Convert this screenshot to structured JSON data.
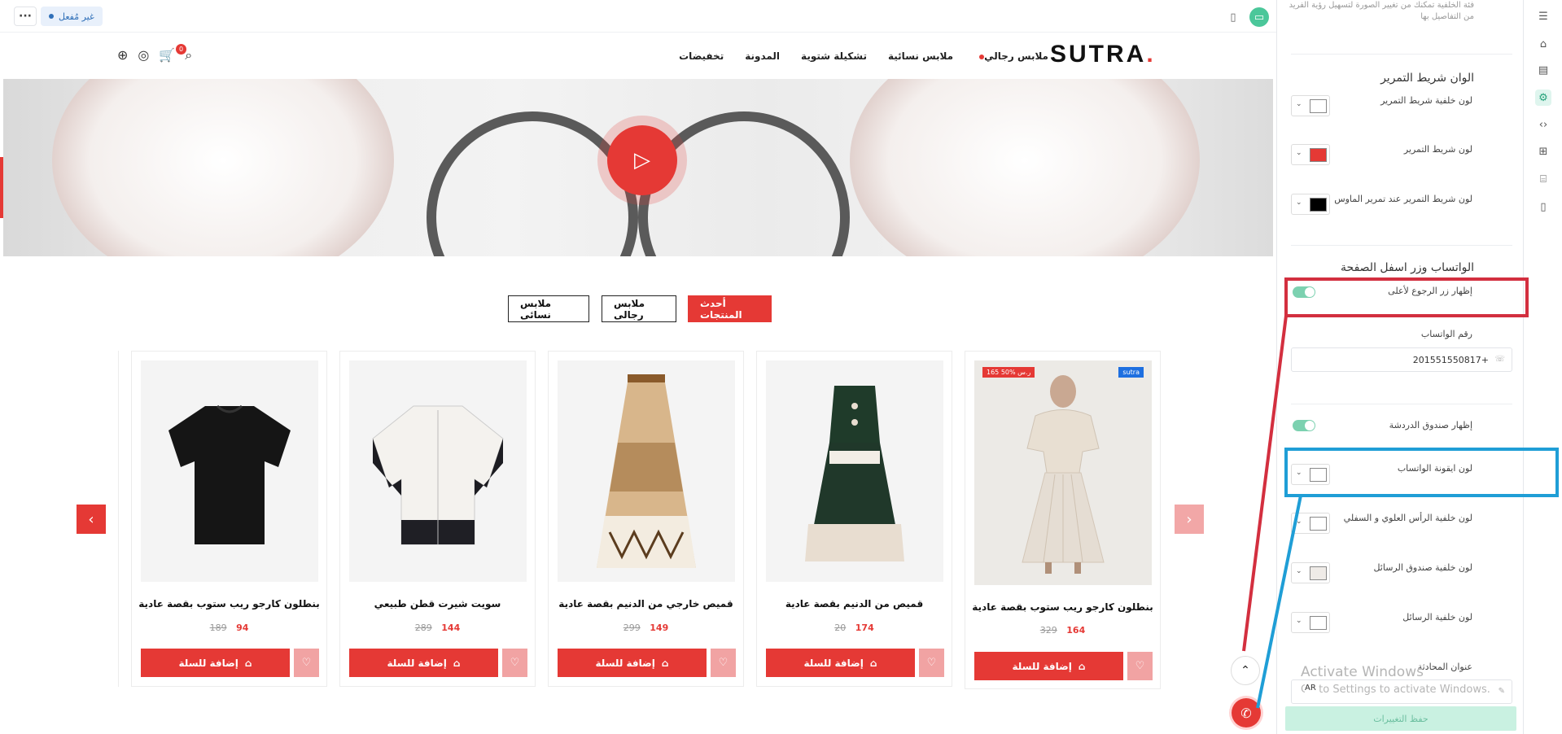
{
  "status_bar": {
    "inactive_label": "غير مُفعل",
    "more_label": "···"
  },
  "header": {
    "logo_text": "SUTRA",
    "logo_dot": ".",
    "nav": [
      "ملابس رجالي",
      "ملابس نسائية",
      "تشكيلة شتوية",
      "المدونة",
      "تخفيضات"
    ],
    "cart_count": "0"
  },
  "tabs": [
    {
      "label": "أحدث المنتجات",
      "active": true
    },
    {
      "label": "ملابس رجالى",
      "active": false
    },
    {
      "label": "ملابس نسائى",
      "active": false
    }
  ],
  "products": [
    {
      "name": "بنطلون كارجو ريب ستوب بقصة عادية",
      "price": "164",
      "old_price": "329",
      "sale_tag": "165 ر.س %50",
      "brand_tag": "sutra",
      "cart_label": "إضافة للسلة",
      "image": "woman-dress"
    },
    {
      "name": "قميص من الدنيم بقصة عادية",
      "price": "174",
      "old_price": "20",
      "cart_label": "إضافة للسلة",
      "image": "green-dress"
    },
    {
      "name": "قميص خارجي من الدنيم بقصة عادية",
      "price": "149",
      "old_price": "299",
      "cart_label": "إضافة للسلة",
      "image": "printed-skirt"
    },
    {
      "name": "سويت شيرت قطن طبيعي",
      "price": "144",
      "old_price": "289",
      "cart_label": "إضافة للسلة",
      "image": "white-shirt"
    },
    {
      "name": "بنطلون كارجو ريب ستوب بقصة عادية",
      "price": "94",
      "old_price": "189",
      "cart_label": "إضافة للسلة",
      "image": "black-tshirt"
    }
  ],
  "panel": {
    "top_note": "فئة الخلفية تمكنك من تغيير الصورة لتسهيل رؤية الفريد من التفاصيل بها",
    "scrollbar_title": "الوان شريط التمرير",
    "scrollbar_items": [
      {
        "label": "لون خلفية شريط التمرير",
        "color": "#ffffff"
      },
      {
        "label": "لون شريط التمرير",
        "color": "#e53935"
      },
      {
        "label": "لون شريط التمرير عند تمرير الماوس",
        "color": "#000000"
      }
    ],
    "whatsapp_title": "الواتساب وزر اسفل الصفحة",
    "show_back_to_top": "إظهار زر الرجوع لأعلى",
    "whatsapp_number_label": "رقم الواتساب",
    "whatsapp_number": "201551550817+",
    "show_chat_box": "إظهار صندوق الدردشة",
    "chat_colors": [
      {
        "label": "لون ايقونة الواتساب",
        "color": "#ffffff"
      },
      {
        "label": "لون خلفية الرأس العلوي و السفلي",
        "color": "#ffffff"
      },
      {
        "label": "لون خلفية صندوق الرسائل",
        "color": "#efebe7"
      },
      {
        "label": "لون خلفية الرسائل",
        "color": "#ffffff"
      }
    ],
    "conversation_title_label": "عنوان المحادثة",
    "lang_code": "AR",
    "save_label": "حفظ التغييرات"
  },
  "windows_activation": {
    "title": "Activate Windows",
    "subtitle": "Go to Settings to activate Windows."
  },
  "colors": {
    "accent": "#e53935",
    "highlight_red": "#d32f3f",
    "highlight_blue": "#1f9ed6",
    "toggle_on": "#7cd1b0"
  }
}
